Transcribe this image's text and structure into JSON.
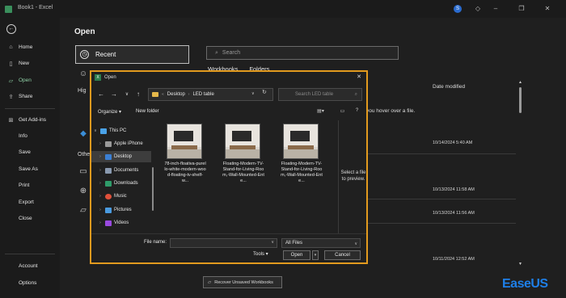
{
  "window": {
    "title": "Book1 - Excel",
    "user_initial": "S"
  },
  "sidebar": {
    "items": [
      {
        "label": "Home",
        "icon": "home-icon"
      },
      {
        "label": "New",
        "icon": "new-file-icon"
      },
      {
        "label": "Open",
        "icon": "folder-open-icon",
        "active": true
      },
      {
        "label": "Share",
        "icon": "share-icon"
      },
      {
        "label": "Get Add-ins",
        "icon": "add-ins-icon"
      },
      {
        "label": "Info"
      },
      {
        "label": "Save"
      },
      {
        "label": "Save As"
      },
      {
        "label": "Print"
      },
      {
        "label": "Export"
      },
      {
        "label": "Close"
      }
    ],
    "bottom_items": [
      {
        "label": "Account"
      },
      {
        "label": "Options"
      }
    ]
  },
  "open_page": {
    "title": "Open",
    "recent_label": "Recent",
    "partial_labels": [
      "Hig",
      "Othe"
    ],
    "search_placeholder": "Search",
    "tabs": [
      "Workbooks",
      "Folders"
    ],
    "date_modified_header": "Date modified",
    "hover_hint": "you hover over a file.",
    "rows": [
      {
        "date": "10/14/2024 5:40 AM"
      },
      {
        "date": "10/13/2024 11:58 AM"
      },
      {
        "date": "10/13/2024 11:56 AM"
      },
      {
        "date": "10/11/2024 12:52 AM"
      }
    ],
    "recover_label": "Recover Unsaved Workbooks"
  },
  "dialog": {
    "title": "Open",
    "breadcrumb": [
      "Desktop",
      "LED table"
    ],
    "search_placeholder": "Search LED table",
    "organize_label": "Organize",
    "new_folder_label": "New folder",
    "tree": [
      {
        "label": "This PC",
        "icon_color": "#4aa3e8",
        "level": 0,
        "chev": "v"
      },
      {
        "label": "Apple iPhone",
        "icon_color": "#9a9a9a",
        "level": 1,
        "chev": ">"
      },
      {
        "label": "Desktop",
        "icon_color": "#3b7fd4",
        "level": 1,
        "chev": ">",
        "selected": true
      },
      {
        "label": "Documents",
        "icon_color": "#8a9ab0",
        "level": 1,
        "chev": ">"
      },
      {
        "label": "Downloads",
        "icon_color": "#2f9c6a",
        "level": 1,
        "chev": ">"
      },
      {
        "label": "Music",
        "icon_color": "#e0503a",
        "level": 1,
        "chev": ">"
      },
      {
        "label": "Pictures",
        "icon_color": "#4a9be0",
        "level": 1,
        "chev": ">"
      },
      {
        "label": "Videos",
        "icon_color": "#9a4ae0",
        "level": 1,
        "chev": ">"
      }
    ],
    "files": [
      {
        "name": "78-inch-floativa-purello-white-modern-wood-floating-tv-shelf-w..."
      },
      {
        "name": "Floating-Modern-TV-Stand-for-Living-Room,-Wall-Mounted-Ente..."
      },
      {
        "name": "Floating-Modern-TV-Stand-for-Living-Room,-Wall-Mounted-Ente..."
      }
    ],
    "preview_text": "Select a file to preview.",
    "file_name_label": "File name:",
    "file_name_value": "",
    "filter_value": "All Files",
    "tools_label": "Tools",
    "open_label": "Open",
    "cancel_label": "Cancel"
  },
  "brand": {
    "text": "EaseUS",
    "color": "#1e7fe8"
  }
}
